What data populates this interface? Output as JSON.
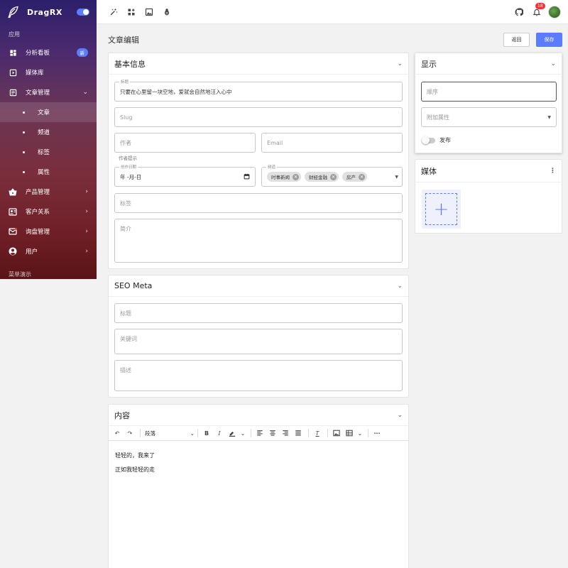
{
  "sidebar": {
    "brand": "DragRX",
    "section_label": "应用",
    "items": [
      {
        "label": "分析看板",
        "badge": "新"
      },
      {
        "label": "媒体库"
      },
      {
        "label": "文章管理"
      },
      {
        "label": "产品管理"
      },
      {
        "label": "客户关系"
      },
      {
        "label": "询盘管理"
      },
      {
        "label": "用户"
      }
    ],
    "sub_items": [
      {
        "label": "文章"
      },
      {
        "label": "频道"
      },
      {
        "label": "标签"
      },
      {
        "label": "属性"
      }
    ],
    "bottom_label": "菜单演示"
  },
  "topbar": {
    "icons": [
      "magic-wand-icon",
      "widgets-icon",
      "image-icon",
      "bug-icon",
      "github-icon",
      "bell-icon"
    ],
    "notification_count": "18"
  },
  "page": {
    "title": "文章编辑",
    "back_label": "返回",
    "save_label": "保存"
  },
  "basic_info": {
    "title": "基本信息",
    "title_field": {
      "label": "标题",
      "value": "只要在心里留一块空地，爱就会自然地汪入心中"
    },
    "slug_placeholder": "Slug",
    "author_placeholder": "作者",
    "author_hint": "作者提示",
    "email_placeholder": "Email",
    "date_field": {
      "label": "创作日期",
      "value": "年 -月-日"
    },
    "channel_field": {
      "label": "频道",
      "chips": [
        "时事新闻",
        "财经金融",
        "房产"
      ]
    },
    "tags_placeholder": "标签",
    "summary_placeholder": "简介"
  },
  "seo": {
    "title": "SEO Meta",
    "title_placeholder": "标题",
    "keywords_placeholder": "关键词",
    "description_placeholder": "描述"
  },
  "content": {
    "title": "内容",
    "paragraph_select": "段落",
    "lines": [
      "轻轻的，我来了",
      "正如我轻轻的走"
    ]
  },
  "display": {
    "title": "显示",
    "order_placeholder": "顺序",
    "attr_placeholder": "附加属性",
    "publish_label": "发布"
  },
  "media": {
    "title": "媒体",
    "add_symbol": "+"
  },
  "colors": {
    "accent": "#5b7cff",
    "badge_red": "#e53935"
  }
}
